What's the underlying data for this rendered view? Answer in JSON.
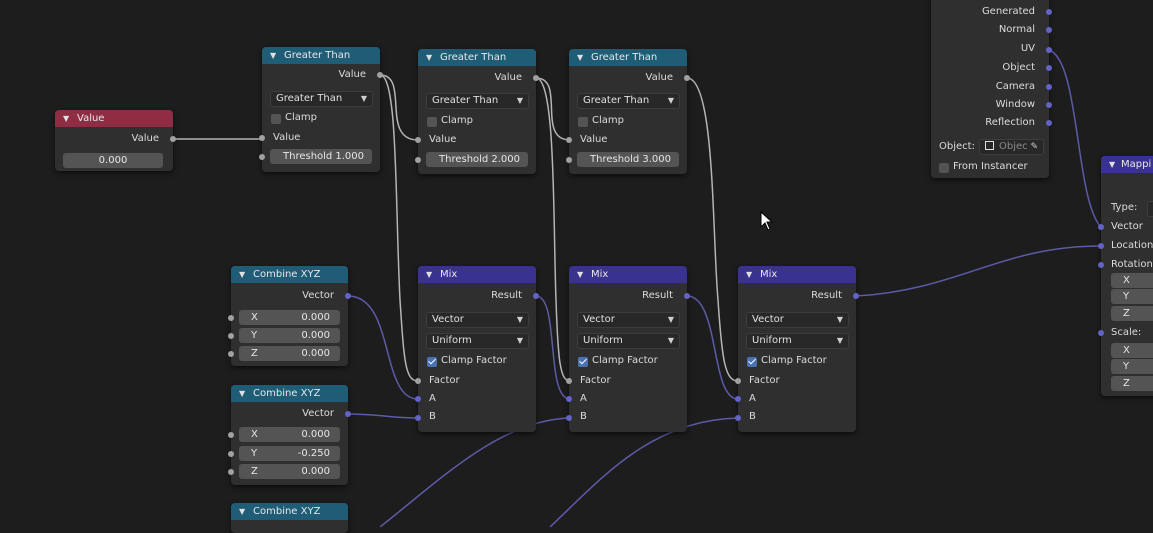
{
  "value_node": {
    "title": "Value",
    "output": "Value",
    "value": "0.000"
  },
  "greater_than_nodes": [
    {
      "title": "Greater Than",
      "output": "Value",
      "operation": "Greater Than",
      "clamp": "Clamp",
      "input": "Value",
      "threshold_label": "Threshold",
      "threshold": "1.000"
    },
    {
      "title": "Greater Than",
      "output": "Value",
      "operation": "Greater Than",
      "clamp": "Clamp",
      "input": "Value",
      "threshold_label": "Threshold",
      "threshold": "2.000"
    },
    {
      "title": "Greater Than",
      "output": "Value",
      "operation": "Greater Than",
      "clamp": "Clamp",
      "input": "Value",
      "threshold_label": "Threshold",
      "threshold": "3.000"
    }
  ],
  "combine_nodes": [
    {
      "title": "Combine XYZ",
      "output": "Vector",
      "x_label": "X",
      "x": "0.000",
      "y_label": "Y",
      "y": "0.000",
      "z_label": "Z",
      "z": "0.000"
    },
    {
      "title": "Combine XYZ",
      "output": "Vector",
      "x_label": "X",
      "x": "0.000",
      "y_label": "Y",
      "y": "-0.250",
      "z_label": "Z",
      "z": "0.000"
    },
    {
      "title": "Combine XYZ"
    }
  ],
  "mix_nodes": [
    {
      "title": "Mix",
      "output": "Result",
      "data_type": "Vector",
      "factor_mode": "Uniform",
      "clamp_factor": "Clamp Factor",
      "factor": "Factor",
      "a": "A",
      "b": "B"
    },
    {
      "title": "Mix",
      "output": "Result",
      "data_type": "Vector",
      "factor_mode": "Uniform",
      "clamp_factor": "Clamp Factor",
      "factor": "Factor",
      "a": "A",
      "b": "B"
    },
    {
      "title": "Mix",
      "output": "Result",
      "data_type": "Vector",
      "factor_mode": "Uniform",
      "clamp_factor": "Clamp Factor",
      "factor": "Factor",
      "a": "A",
      "b": "B"
    }
  ],
  "texcoord_node": {
    "outputs": [
      "Generated",
      "Normal",
      "UV",
      "Object",
      "Camera",
      "Window",
      "Reflection"
    ],
    "object_label": "Object:",
    "object_placeholder": "Objec",
    "from_instancer": "From Instancer"
  },
  "mapping_node": {
    "title": "Mappi",
    "type_label": "Type:",
    "vector": "Vector",
    "location": "Location",
    "rotation": "Rotation:",
    "scale": "Scale:",
    "axes": [
      "X",
      "Y",
      "Z"
    ]
  },
  "colors": {
    "background": "#1d1d1d",
    "value_header": "#8f2d45",
    "math_header": "#1f5c76",
    "mix_header": "#3a3290",
    "socket_grey": "#a1a1a1",
    "socket_purple": "#6363c7",
    "wire_grey": "#b5b5b5",
    "wire_purple": "#5d5aa8"
  }
}
